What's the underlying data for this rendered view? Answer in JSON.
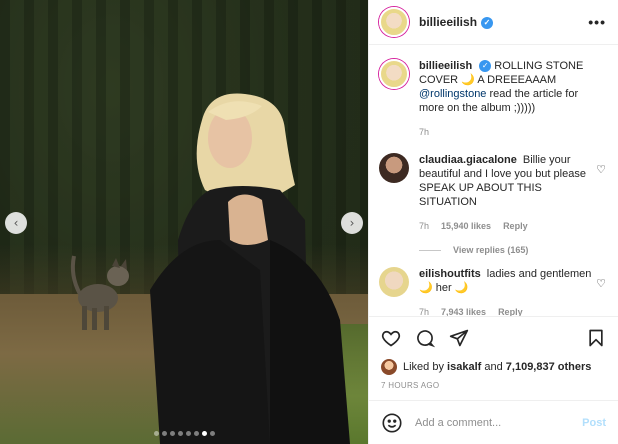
{
  "post": {
    "username": "billieeilish",
    "verified_badge": "✓",
    "more_label": "•••"
  },
  "caption": {
    "username": "billieeilish",
    "text_before": "ROLLING STONE COVER 🌙 A DREEEAAAM ",
    "mention": "@rollingstone",
    "text_after": " read the article for more on the album ;)))))",
    "time": "7h"
  },
  "comments": [
    {
      "username": "claudiaa.giacalone",
      "text": "Billie your beautiful and I love you but please SPEAK UP ABOUT THIS SITUATION",
      "time": "7h",
      "likes": "15,940 likes",
      "reply": "Reply",
      "view_replies": "View replies (165)"
    },
    {
      "username": "eilishoutfits",
      "text": "ladies and gentlemen 🌙 her 🌙",
      "time": "7h",
      "likes": "7,943 likes",
      "reply": "Reply"
    }
  ],
  "likes_line": {
    "prefix": "Liked by ",
    "user": "isakalf",
    "middle": " and ",
    "count": "7,109,837 others"
  },
  "timestamp": "7 HOURS AGO",
  "add_comment": {
    "placeholder": "Add a comment...",
    "post_label": "Post"
  },
  "carousel": {
    "prev_icon": "‹",
    "next_icon": "›",
    "total_slides": 8,
    "active_index": 6
  },
  "colors": {
    "verified": "#3897f0",
    "link": "#00376b",
    "post_button": "#b2dffc",
    "muted": "#8e8e8e"
  }
}
